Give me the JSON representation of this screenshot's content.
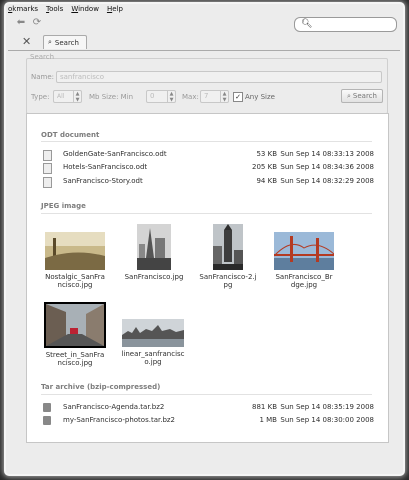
{
  "menubar": [
    "okmarks",
    "Tools",
    "Window",
    "Help"
  ],
  "tabs": [
    {
      "label": "Search"
    }
  ],
  "search_form": {
    "legend": "Search",
    "name_label": "Name:",
    "name_value": "sanfrancisco",
    "type_label": "Type:",
    "type_value": "All",
    "mb_size_label": "Mb Size: Min",
    "min_value": "0",
    "max_label": "Max:",
    "max_value": "7",
    "any_size_label": "Any Size",
    "any_size_checked": true,
    "search_button": "Search"
  },
  "groups": {
    "odt": {
      "title": "ODT document",
      "files": [
        {
          "name": "GoldenGate-SanFrancisco.odt",
          "size": "53 KB",
          "date": "Sun Sep 14 08:33:13 2008"
        },
        {
          "name": "Hotels-SanFrancisco.odt",
          "size": "205 KB",
          "date": "Sun Sep 14 08:34:36 2008"
        },
        {
          "name": "SanFrancisco-Story.odt",
          "size": "94 KB",
          "date": "Sun Sep 14 08:32:29 2008"
        }
      ]
    },
    "jpeg": {
      "title": "JPEG image",
      "images": [
        {
          "caption1": "Nostalgic_SanFra",
          "caption2": "ncisco.jpg"
        },
        {
          "caption1": "SanFrancisco.jpg",
          "caption2": ""
        },
        {
          "caption1": "SanFrancisco-2.j",
          "caption2": "pg"
        },
        {
          "caption1": "SanFrancisco_Br",
          "caption2": "dge.jpg"
        },
        {
          "caption1": "Street_in_SanFra",
          "caption2": "ncisco.jpg"
        },
        {
          "caption1": "linear_sanfrancisc",
          "caption2": "o.jpg"
        }
      ]
    },
    "tar": {
      "title": "Tar archive (bzip-compressed)",
      "files": [
        {
          "name": "SanFrancisco-Agenda.tar.bz2",
          "size": "881 KB",
          "date": "Sun Sep 14 08:35:19 2008"
        },
        {
          "name": "my-SanFrancisco-photos.tar.bz2",
          "size": "1 MB",
          "date": "Sun Sep 14 08:30:00 2008"
        }
      ]
    }
  },
  "icons": [
    "back-icon",
    "forward-icon",
    "search-icon",
    "close-icon",
    "document-icon",
    "archive-icon"
  ]
}
